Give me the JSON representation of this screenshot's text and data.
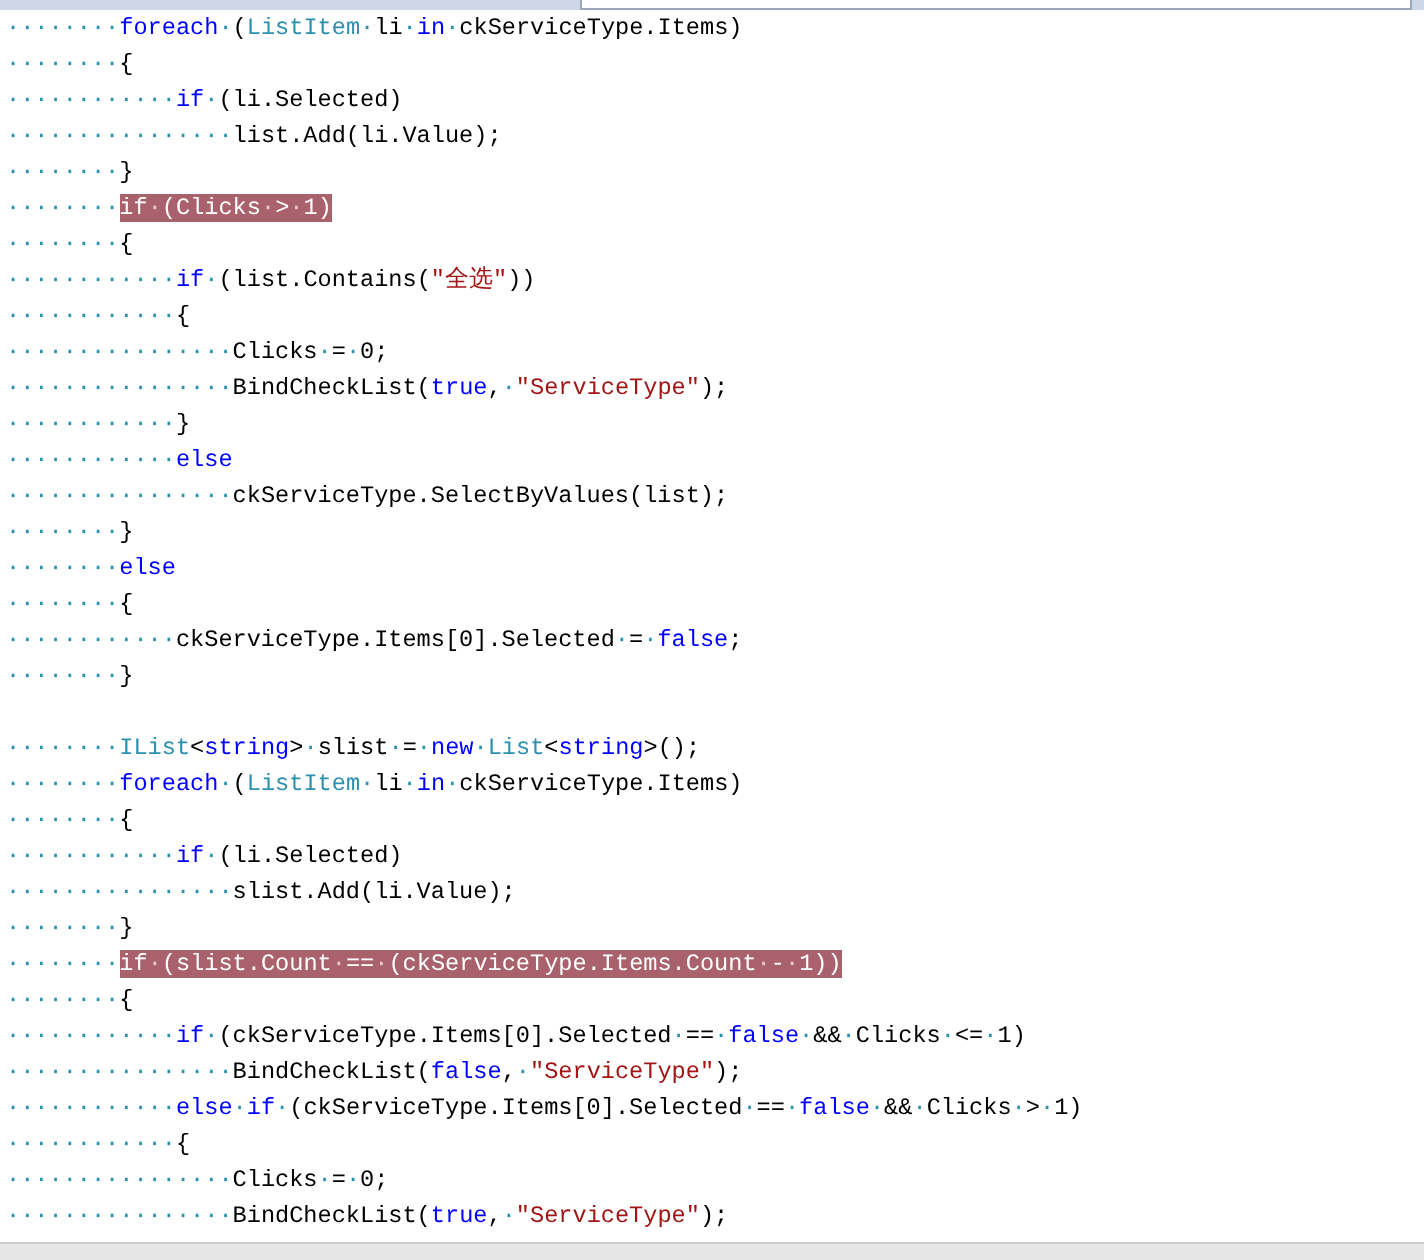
{
  "editor": {
    "lines": [
      {
        "kind": "code",
        "highlighted": false,
        "tokens": [
          {
            "kind": "ws",
            "text": "········"
          },
          {
            "kind": "keyword",
            "text": "foreach"
          },
          {
            "kind": "ws",
            "text": "·"
          },
          {
            "kind": "plain",
            "text": "("
          },
          {
            "kind": "type",
            "text": "ListItem"
          },
          {
            "kind": "ws",
            "text": "·"
          },
          {
            "kind": "plain",
            "text": "li"
          },
          {
            "kind": "ws",
            "text": "·"
          },
          {
            "kind": "keyword",
            "text": "in"
          },
          {
            "kind": "ws",
            "text": "·"
          },
          {
            "kind": "plain",
            "text": "ckServiceType.Items)"
          }
        ]
      },
      {
        "kind": "code",
        "highlighted": false,
        "tokens": [
          {
            "kind": "ws",
            "text": "········"
          },
          {
            "kind": "plain",
            "text": "{"
          }
        ]
      },
      {
        "kind": "code",
        "highlighted": false,
        "tokens": [
          {
            "kind": "ws",
            "text": "············"
          },
          {
            "kind": "keyword",
            "text": "if"
          },
          {
            "kind": "ws",
            "text": "·"
          },
          {
            "kind": "plain",
            "text": "(li.Selected)"
          }
        ]
      },
      {
        "kind": "code",
        "highlighted": false,
        "tokens": [
          {
            "kind": "ws",
            "text": "················"
          },
          {
            "kind": "plain",
            "text": "list.Add(li.Value);"
          }
        ]
      },
      {
        "kind": "code",
        "highlighted": false,
        "tokens": [
          {
            "kind": "ws",
            "text": "········"
          },
          {
            "kind": "plain",
            "text": "}"
          }
        ]
      },
      {
        "kind": "code",
        "highlighted": true,
        "tokens": [
          {
            "kind": "ws",
            "text": "········"
          },
          {
            "kind": "keyword",
            "text": "if"
          },
          {
            "kind": "ws",
            "text": "·"
          },
          {
            "kind": "plain",
            "text": "(Clicks"
          },
          {
            "kind": "ws",
            "text": "·"
          },
          {
            "kind": "plain",
            "text": ">"
          },
          {
            "kind": "ws",
            "text": "·"
          },
          {
            "kind": "plain",
            "text": "1)"
          }
        ]
      },
      {
        "kind": "code",
        "highlighted": false,
        "tokens": [
          {
            "kind": "ws",
            "text": "········"
          },
          {
            "kind": "plain",
            "text": "{"
          }
        ]
      },
      {
        "kind": "code",
        "highlighted": false,
        "tokens": [
          {
            "kind": "ws",
            "text": "············"
          },
          {
            "kind": "keyword",
            "text": "if"
          },
          {
            "kind": "ws",
            "text": "·"
          },
          {
            "kind": "plain",
            "text": "(list.Contains("
          },
          {
            "kind": "string",
            "text": "\"全选\""
          },
          {
            "kind": "plain",
            "text": "))"
          }
        ]
      },
      {
        "kind": "code",
        "highlighted": false,
        "tokens": [
          {
            "kind": "ws",
            "text": "············"
          },
          {
            "kind": "plain",
            "text": "{"
          }
        ]
      },
      {
        "kind": "code",
        "highlighted": false,
        "tokens": [
          {
            "kind": "ws",
            "text": "················"
          },
          {
            "kind": "plain",
            "text": "Clicks"
          },
          {
            "kind": "ws",
            "text": "·"
          },
          {
            "kind": "plain",
            "text": "="
          },
          {
            "kind": "ws",
            "text": "·"
          },
          {
            "kind": "plain",
            "text": "0;"
          }
        ]
      },
      {
        "kind": "code",
        "highlighted": false,
        "tokens": [
          {
            "kind": "ws",
            "text": "················"
          },
          {
            "kind": "plain",
            "text": "BindCheckList("
          },
          {
            "kind": "keyword",
            "text": "true"
          },
          {
            "kind": "plain",
            "text": ","
          },
          {
            "kind": "ws",
            "text": "·"
          },
          {
            "kind": "string",
            "text": "\"ServiceType\""
          },
          {
            "kind": "plain",
            "text": ");"
          }
        ]
      },
      {
        "kind": "code",
        "highlighted": false,
        "tokens": [
          {
            "kind": "ws",
            "text": "············"
          },
          {
            "kind": "plain",
            "text": "}"
          }
        ]
      },
      {
        "kind": "code",
        "highlighted": false,
        "tokens": [
          {
            "kind": "ws",
            "text": "············"
          },
          {
            "kind": "keyword",
            "text": "else"
          }
        ]
      },
      {
        "kind": "code",
        "highlighted": false,
        "tokens": [
          {
            "kind": "ws",
            "text": "················"
          },
          {
            "kind": "plain",
            "text": "ckServiceType.SelectByValues(list);"
          }
        ]
      },
      {
        "kind": "code",
        "highlighted": false,
        "tokens": [
          {
            "kind": "ws",
            "text": "········"
          },
          {
            "kind": "plain",
            "text": "}"
          }
        ]
      },
      {
        "kind": "code",
        "highlighted": false,
        "tokens": [
          {
            "kind": "ws",
            "text": "········"
          },
          {
            "kind": "keyword",
            "text": "else"
          }
        ]
      },
      {
        "kind": "code",
        "highlighted": false,
        "tokens": [
          {
            "kind": "ws",
            "text": "········"
          },
          {
            "kind": "plain",
            "text": "{"
          }
        ]
      },
      {
        "kind": "code",
        "highlighted": false,
        "tokens": [
          {
            "kind": "ws",
            "text": "············"
          },
          {
            "kind": "plain",
            "text": "ckServiceType.Items[0].Selected"
          },
          {
            "kind": "ws",
            "text": "·"
          },
          {
            "kind": "plain",
            "text": "="
          },
          {
            "kind": "ws",
            "text": "·"
          },
          {
            "kind": "keyword",
            "text": "false"
          },
          {
            "kind": "plain",
            "text": ";"
          }
        ]
      },
      {
        "kind": "code",
        "highlighted": false,
        "tokens": [
          {
            "kind": "ws",
            "text": "········"
          },
          {
            "kind": "plain",
            "text": "}"
          }
        ]
      },
      {
        "kind": "blank"
      },
      {
        "kind": "code",
        "highlighted": false,
        "tokens": [
          {
            "kind": "ws",
            "text": "········"
          },
          {
            "kind": "type",
            "text": "IList"
          },
          {
            "kind": "plain",
            "text": "<"
          },
          {
            "kind": "keyword",
            "text": "string"
          },
          {
            "kind": "plain",
            "text": ">"
          },
          {
            "kind": "ws",
            "text": "·"
          },
          {
            "kind": "plain",
            "text": "slist"
          },
          {
            "kind": "ws",
            "text": "·"
          },
          {
            "kind": "plain",
            "text": "="
          },
          {
            "kind": "ws",
            "text": "·"
          },
          {
            "kind": "keyword",
            "text": "new"
          },
          {
            "kind": "ws",
            "text": "·"
          },
          {
            "kind": "type",
            "text": "List"
          },
          {
            "kind": "plain",
            "text": "<"
          },
          {
            "kind": "keyword",
            "text": "string"
          },
          {
            "kind": "plain",
            "text": ">();"
          }
        ]
      },
      {
        "kind": "code",
        "highlighted": false,
        "tokens": [
          {
            "kind": "ws",
            "text": "········"
          },
          {
            "kind": "keyword",
            "text": "foreach"
          },
          {
            "kind": "ws",
            "text": "·"
          },
          {
            "kind": "plain",
            "text": "("
          },
          {
            "kind": "type",
            "text": "ListItem"
          },
          {
            "kind": "ws",
            "text": "·"
          },
          {
            "kind": "plain",
            "text": "li"
          },
          {
            "kind": "ws",
            "text": "·"
          },
          {
            "kind": "keyword",
            "text": "in"
          },
          {
            "kind": "ws",
            "text": "·"
          },
          {
            "kind": "plain",
            "text": "ckServiceType.Items)"
          }
        ]
      },
      {
        "kind": "code",
        "highlighted": false,
        "tokens": [
          {
            "kind": "ws",
            "text": "········"
          },
          {
            "kind": "plain",
            "text": "{"
          }
        ]
      },
      {
        "kind": "code",
        "highlighted": false,
        "tokens": [
          {
            "kind": "ws",
            "text": "············"
          },
          {
            "kind": "keyword",
            "text": "if"
          },
          {
            "kind": "ws",
            "text": "·"
          },
          {
            "kind": "plain",
            "text": "(li.Selected)"
          }
        ]
      },
      {
        "kind": "code",
        "highlighted": false,
        "tokens": [
          {
            "kind": "ws",
            "text": "················"
          },
          {
            "kind": "plain",
            "text": "slist.Add(li.Value);"
          }
        ]
      },
      {
        "kind": "code",
        "highlighted": false,
        "tokens": [
          {
            "kind": "ws",
            "text": "········"
          },
          {
            "kind": "plain",
            "text": "}"
          }
        ]
      },
      {
        "kind": "code",
        "highlighted": true,
        "tokens": [
          {
            "kind": "ws",
            "text": "········"
          },
          {
            "kind": "keyword",
            "text": "if"
          },
          {
            "kind": "ws",
            "text": "·"
          },
          {
            "kind": "plain",
            "text": "(slist.Count"
          },
          {
            "kind": "ws",
            "text": "·"
          },
          {
            "kind": "plain",
            "text": "=="
          },
          {
            "kind": "ws",
            "text": "·"
          },
          {
            "kind": "plain",
            "text": "(ckServiceType.Items.Count"
          },
          {
            "kind": "ws",
            "text": "·"
          },
          {
            "kind": "plain",
            "text": "-"
          },
          {
            "kind": "ws",
            "text": "·"
          },
          {
            "kind": "plain",
            "text": "1))"
          }
        ]
      },
      {
        "kind": "code",
        "highlighted": false,
        "tokens": [
          {
            "kind": "ws",
            "text": "········"
          },
          {
            "kind": "plain",
            "text": "{"
          }
        ]
      },
      {
        "kind": "code",
        "highlighted": false,
        "tokens": [
          {
            "kind": "ws",
            "text": "············"
          },
          {
            "kind": "keyword",
            "text": "if"
          },
          {
            "kind": "ws",
            "text": "·"
          },
          {
            "kind": "plain",
            "text": "(ckServiceType.Items[0].Selected"
          },
          {
            "kind": "ws",
            "text": "·"
          },
          {
            "kind": "plain",
            "text": "=="
          },
          {
            "kind": "ws",
            "text": "·"
          },
          {
            "kind": "keyword",
            "text": "false"
          },
          {
            "kind": "ws",
            "text": "·"
          },
          {
            "kind": "plain",
            "text": "&&"
          },
          {
            "kind": "ws",
            "text": "·"
          },
          {
            "kind": "plain",
            "text": "Clicks"
          },
          {
            "kind": "ws",
            "text": "·"
          },
          {
            "kind": "plain",
            "text": "<="
          },
          {
            "kind": "ws",
            "text": "·"
          },
          {
            "kind": "plain",
            "text": "1)"
          }
        ]
      },
      {
        "kind": "code",
        "highlighted": false,
        "tokens": [
          {
            "kind": "ws",
            "text": "················"
          },
          {
            "kind": "plain",
            "text": "BindCheckList("
          },
          {
            "kind": "keyword",
            "text": "false"
          },
          {
            "kind": "plain",
            "text": ","
          },
          {
            "kind": "ws",
            "text": "·"
          },
          {
            "kind": "string",
            "text": "\"ServiceType\""
          },
          {
            "kind": "plain",
            "text": ");"
          }
        ]
      },
      {
        "kind": "code",
        "highlighted": false,
        "tokens": [
          {
            "kind": "ws",
            "text": "············"
          },
          {
            "kind": "keyword",
            "text": "else"
          },
          {
            "kind": "ws",
            "text": "·"
          },
          {
            "kind": "keyword",
            "text": "if"
          },
          {
            "kind": "ws",
            "text": "·"
          },
          {
            "kind": "plain",
            "text": "(ckServiceType.Items[0].Selected"
          },
          {
            "kind": "ws",
            "text": "·"
          },
          {
            "kind": "plain",
            "text": "=="
          },
          {
            "kind": "ws",
            "text": "·"
          },
          {
            "kind": "keyword",
            "text": "false"
          },
          {
            "kind": "ws",
            "text": "·"
          },
          {
            "kind": "plain",
            "text": "&&"
          },
          {
            "kind": "ws",
            "text": "·"
          },
          {
            "kind": "plain",
            "text": "Clicks"
          },
          {
            "kind": "ws",
            "text": "·"
          },
          {
            "kind": "plain",
            "text": ">"
          },
          {
            "kind": "ws",
            "text": "·"
          },
          {
            "kind": "plain",
            "text": "1)"
          }
        ]
      },
      {
        "kind": "code",
        "highlighted": false,
        "tokens": [
          {
            "kind": "ws",
            "text": "············"
          },
          {
            "kind": "plain",
            "text": "{"
          }
        ]
      },
      {
        "kind": "code",
        "highlighted": false,
        "tokens": [
          {
            "kind": "ws",
            "text": "················"
          },
          {
            "kind": "plain",
            "text": "Clicks"
          },
          {
            "kind": "ws",
            "text": "·"
          },
          {
            "kind": "plain",
            "text": "="
          },
          {
            "kind": "ws",
            "text": "·"
          },
          {
            "kind": "plain",
            "text": "0;"
          }
        ]
      },
      {
        "kind": "code",
        "highlighted": false,
        "tokens": [
          {
            "kind": "ws",
            "text": "················"
          },
          {
            "kind": "plain",
            "text": "BindCheckList("
          },
          {
            "kind": "keyword",
            "text": "true"
          },
          {
            "kind": "plain",
            "text": ","
          },
          {
            "kind": "ws",
            "text": "·"
          },
          {
            "kind": "string",
            "text": "\"ServiceType\""
          },
          {
            "kind": "plain",
            "text": ");"
          }
        ]
      }
    ]
  }
}
